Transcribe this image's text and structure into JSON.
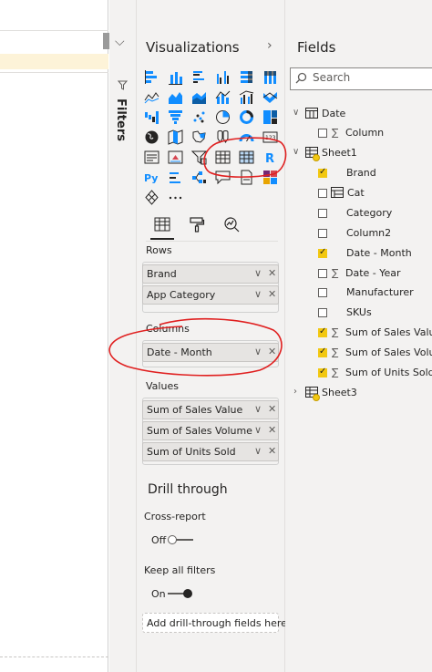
{
  "visualizations": {
    "title": "Visualizations",
    "build_tab": "Build visual",
    "format_tab": "Format",
    "analytics_tab": "Analytics"
  },
  "filters": {
    "label": "Filters"
  },
  "wells": {
    "rows_label": "Rows",
    "rows": [
      "Brand",
      "App Category"
    ],
    "columns_label": "Columns",
    "columns": [
      "Date - Month"
    ],
    "values_label": "Values",
    "values": [
      "Sum of Sales Value",
      "Sum of Sales Volume",
      "Sum of Units Sold"
    ]
  },
  "drill": {
    "title": "Drill through",
    "cross_report_label": "Cross-report",
    "cross_report_state": "Off",
    "keep_filters_label": "Keep all filters",
    "keep_filters_state": "On",
    "add_fields": "Add drill-through fields here"
  },
  "fields": {
    "title": "Fields",
    "search_placeholder": "Search",
    "date_table": "Date",
    "date_column": "Column",
    "sheet1": "Sheet1",
    "sheet1_items": [
      {
        "name": "Brand",
        "checked": true,
        "sigma": false
      },
      {
        "name": "Cat",
        "checked": false,
        "sigma": false,
        "hierarchy": true
      },
      {
        "name": "Category",
        "checked": false,
        "sigma": false
      },
      {
        "name": "Column2",
        "checked": false,
        "sigma": false
      },
      {
        "name": "Date - Month",
        "checked": true,
        "sigma": false
      },
      {
        "name": "Date - Year",
        "checked": false,
        "sigma": true
      },
      {
        "name": "Manufacturer",
        "checked": false,
        "sigma": false
      },
      {
        "name": "SKUs",
        "checked": false,
        "sigma": false
      },
      {
        "name": "Sum of Sales Value",
        "checked": true,
        "sigma": true
      },
      {
        "name": "Sum of Sales Volume",
        "checked": true,
        "sigma": true
      },
      {
        "name": "Sum of Units Sold",
        "checked": true,
        "sigma": true
      }
    ],
    "sheet3": "Sheet3"
  },
  "colors": {
    "accent_yellow": "#f2c811",
    "annotation_red": "#e02020",
    "viz_blue": "#118dff",
    "pane_bg": "#f3f2f1"
  }
}
